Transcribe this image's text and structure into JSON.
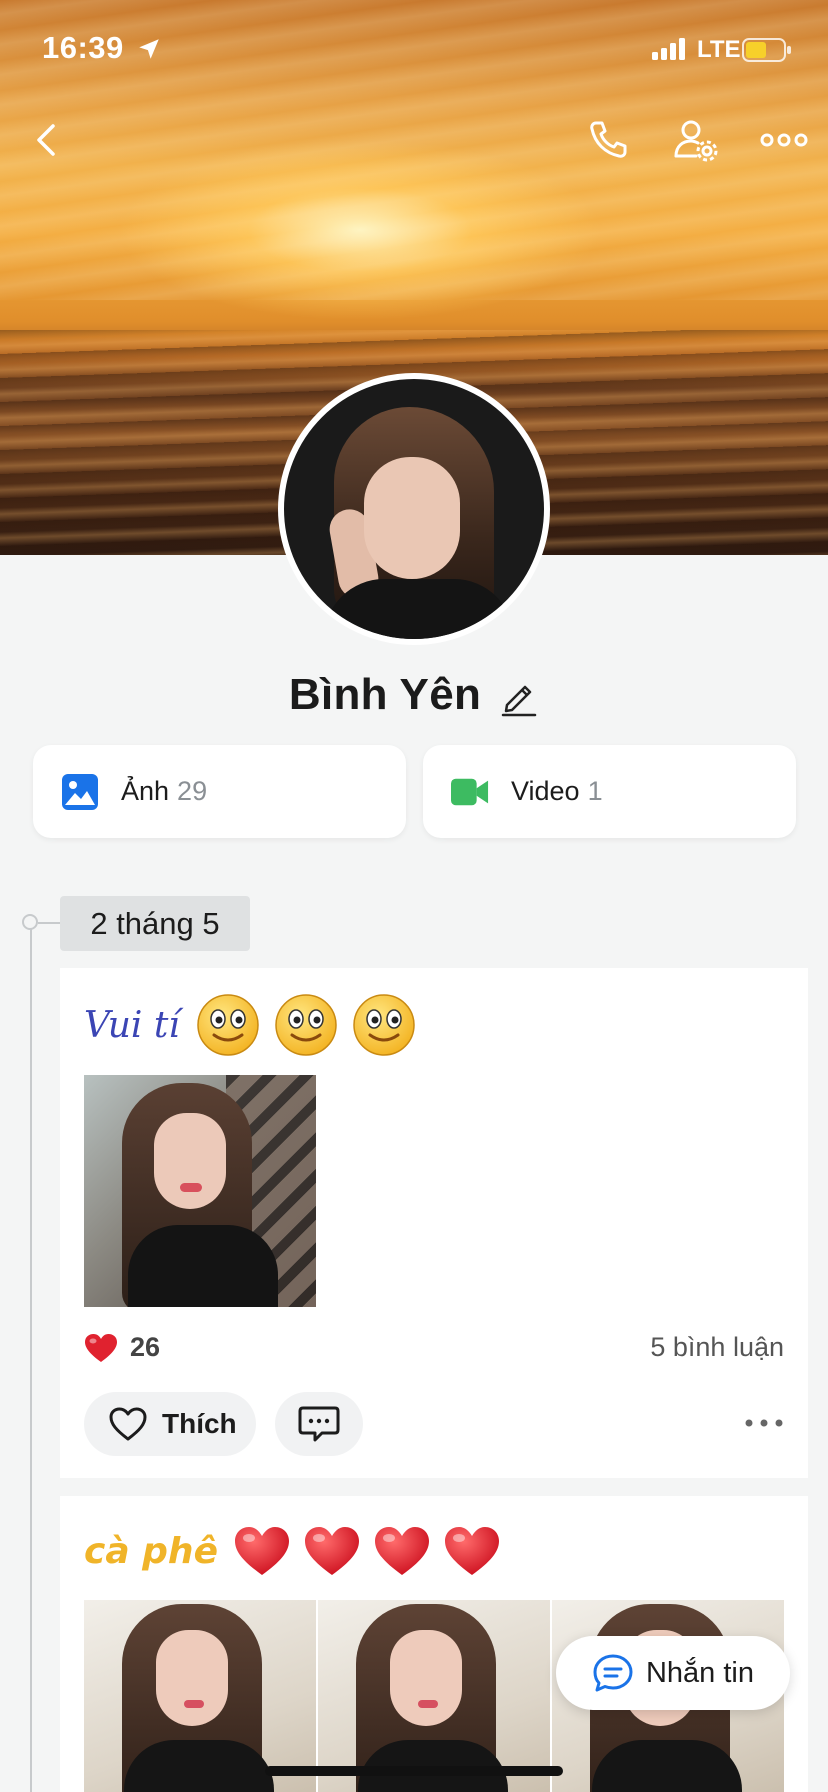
{
  "status_bar": {
    "time": "16:39",
    "network": "LTE"
  },
  "profile": {
    "name": "Bình Yên"
  },
  "media": {
    "photos": {
      "label": "Ảnh",
      "count": "29"
    },
    "videos": {
      "label": "Video",
      "count": "1"
    }
  },
  "timeline": {
    "date": "2 tháng 5"
  },
  "posts": [
    {
      "caption": "Vui tí",
      "emoji": [
        "smiling-face",
        "smiling-face",
        "smiling-face"
      ],
      "likes": "26",
      "comments": "5 bình luận",
      "like_label": "Thích"
    },
    {
      "caption": "cà phê",
      "emoji": [
        "red-heart",
        "red-heart",
        "red-heart",
        "red-heart"
      ]
    }
  ],
  "message_button": {
    "label": "Nhắn tin"
  },
  "colors": {
    "accent_blue": "#1a73e8",
    "video_green": "#3dbb61",
    "heart_red": "#e0222f",
    "cafe_yellow": "#f0b429",
    "script_blue": "#3b45b4"
  }
}
